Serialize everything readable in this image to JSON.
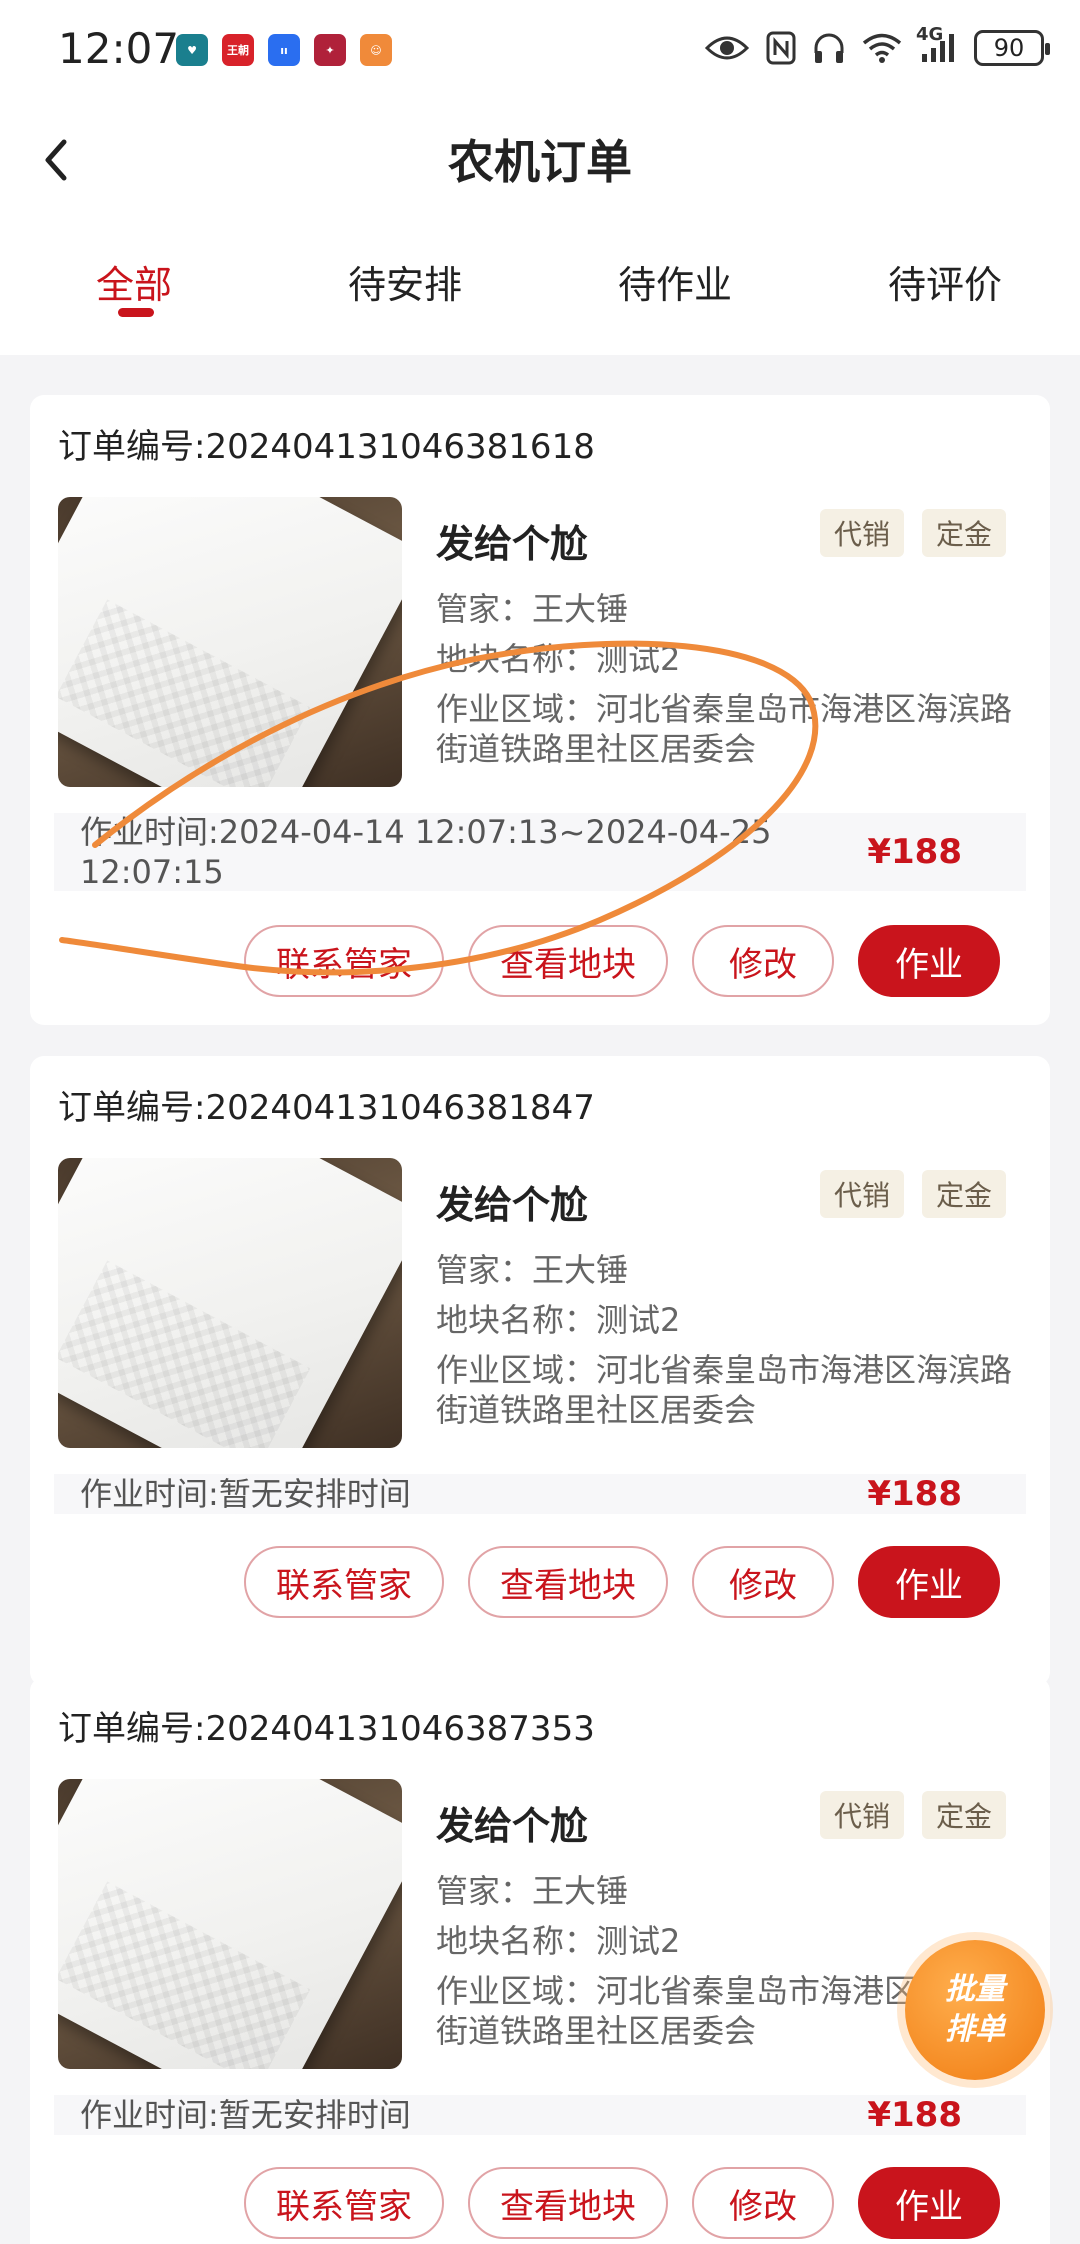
{
  "status_bar": {
    "time": "12:07",
    "battery": "90",
    "network": "4G",
    "app_icons": [
      {
        "name": "health-app-icon",
        "label": "",
        "color": "#1a7f8e"
      },
      {
        "name": "wangchao-app-icon",
        "label": "王朝",
        "color": "#d8222a"
      },
      {
        "name": "voice-app-icon",
        "label": "",
        "color": "#2a6ef0"
      },
      {
        "name": "game-app-icon",
        "label": "",
        "color": "#b0213a"
      },
      {
        "name": "shop-app-icon",
        "label": "",
        "color": "#f08a3a"
      }
    ]
  },
  "navbar": {
    "title": "农机订单"
  },
  "tabs": [
    {
      "label": "全部",
      "active": true
    },
    {
      "label": "待安排",
      "active": false
    },
    {
      "label": "待作业",
      "active": false
    },
    {
      "label": "待评价",
      "active": false
    }
  ],
  "orders": [
    {
      "order_no": "订单编号:20240413104638161‌8",
      "product": "发给个尬",
      "tags": [
        "代销",
        "定金"
      ],
      "manager": "管家：王大锤",
      "plot": "地块名称：测试2",
      "area": "作业区域：河北省秦皇岛市海港区海滨路街道铁路里社区居委会",
      "work_time": "作业时间:2024-04-14 12:07:13~2024-04-25 12:07:15",
      "price": "¥188",
      "buttons": [
        "联系管家",
        "查看地块",
        "修改",
        "作业"
      ]
    },
    {
      "order_no": "订单编号:20240413104638184‌7",
      "product": "发给个尬",
      "tags": [
        "代销",
        "定金"
      ],
      "manager": "管家：王大锤",
      "plot": "地块名称：测试2",
      "area": "作业区域：河北省秦皇岛市海港区海滨路街道铁路里社区居委会",
      "work_time": "作业时间:暂无安排时间",
      "price": "¥188",
      "buttons": [
        "联系管家",
        "查看地块",
        "修改",
        "作业"
      ]
    },
    {
      "order_no": "订单编号:20240413104638735‌3",
      "product": "发给个尬",
      "tags": [
        "代销",
        "定金"
      ],
      "manager": "管家：王大锤",
      "plot": "地块名称：测试2",
      "area": "作业区域：河北省秦皇岛市海港区海滨路街道铁路里社区居委会",
      "work_time": "作业时间:暂无安排时间",
      "price": "¥188",
      "buttons": [
        "联系管家",
        "查看地块",
        "修改",
        "作业"
      ]
    }
  ],
  "fab": {
    "line1": "批量",
    "line2": "排单"
  },
  "colors": {
    "accent": "#c9141c",
    "fab": "#f07c12",
    "annotation": "#ef8a3a"
  }
}
